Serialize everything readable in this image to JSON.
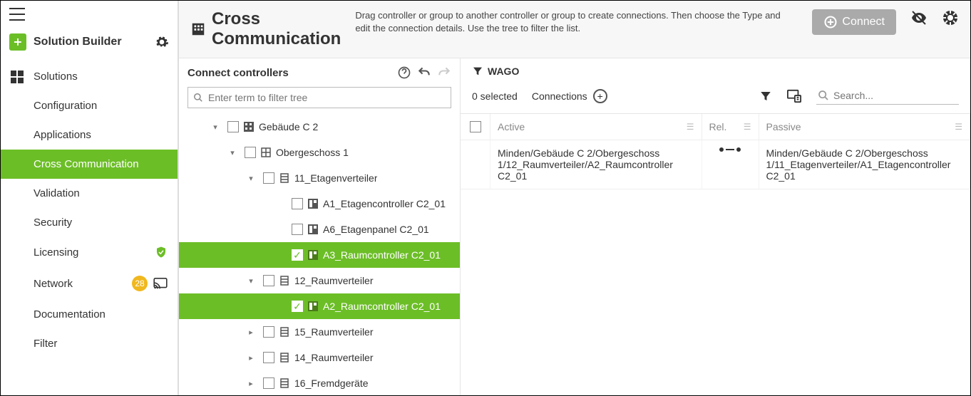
{
  "brand": {
    "title": "Solution Builder"
  },
  "nav": {
    "items": [
      {
        "label": "Solutions"
      },
      {
        "label": "Configuration"
      },
      {
        "label": "Applications"
      },
      {
        "label": "Cross Communication"
      },
      {
        "label": "Validation"
      },
      {
        "label": "Security"
      },
      {
        "label": "Licensing"
      },
      {
        "label": "Network",
        "badge": "28"
      },
      {
        "label": "Documentation"
      },
      {
        "label": "Filter"
      }
    ]
  },
  "header": {
    "title": "Cross Communication",
    "description": "Drag controller or group to another controller or group to create connections. Then choose the Type and edit the connection details. Use the tree to filter the list.",
    "connect_label": "Connect"
  },
  "left": {
    "title": "Connect controllers",
    "filter_placeholder": "Enter term to filter tree",
    "tree": {
      "n0": "Gebäude C 2",
      "n1": "Obergeschoss 1",
      "n2": "11_Etagenverteiler",
      "n3": "A1_Etagencontroller C2_01",
      "n4": "A6_Etagenpanel C2_01",
      "n5": "A3_Raumcontroller C2_01",
      "n6": "12_Raumverteiler",
      "n7": "A2_Raumcontroller C2_01",
      "n8": "15_Raumverteiler",
      "n9": "14_Raumverteiler",
      "n10": "16_Fremdgeräte"
    }
  },
  "right": {
    "filter_tag": "WAGO",
    "selected_text": "0 selected",
    "connections_label": "Connections",
    "search_placeholder": "Search...",
    "columns": {
      "active": "Active",
      "rel": "Rel.",
      "passive": "Passive"
    },
    "row1": {
      "active": "Minden/Gebäude C 2/Obergeschoss 1/12_Raumverteiler/A2_Raumcontroller C2_01",
      "passive": "Minden/Gebäude C 2/Obergeschoss 1/11_Etagenverteiler/A1_Etagencontroller C2_01"
    }
  }
}
